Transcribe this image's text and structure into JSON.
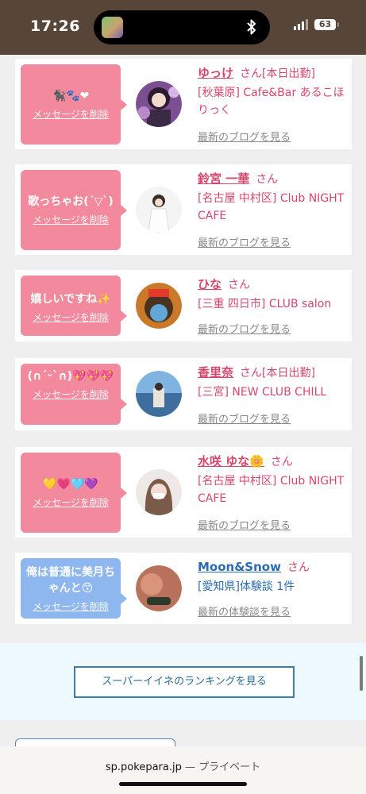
{
  "status": {
    "time": "17:26",
    "battery": "63"
  },
  "items": [
    {
      "message": "🐈‍⬛🐾❤",
      "delete_label": "メッセージを削除",
      "name": "ゆっけ",
      "san": "さん",
      "badge": "[本日出勤]",
      "shop": "[秋葉原] Cafe&Bar あるこほりっく",
      "link": "最新のブログを見る"
    },
    {
      "message": "歌っちゃお(´▽`)",
      "delete_label": "メッセージを削除",
      "name": "鈴宮 一華",
      "san": "さん",
      "badge": "",
      "shop": "[名古屋 中村区] Club NIGHT CAFE",
      "link": "最新のブログを見る"
    },
    {
      "message": "嬉しいですね✨",
      "delete_label": "メッセージを削除",
      "name": "ひな",
      "san": "さん",
      "badge": "",
      "shop": "[三重 四日市] CLUB salon",
      "link": "最新のブログを見る"
    },
    {
      "message": "(∩ˊᵕˋ∩)💖💖💖",
      "delete_label": "メッセージを削除",
      "name": "香里奈",
      "san": "さん",
      "badge": "[本日出勤]",
      "shop": "[三宮] NEW CLUB CHILL",
      "link": "最新のブログを見る"
    },
    {
      "message": "💛💗🩵💜",
      "delete_label": "メッセージを削除",
      "name": "水咲 ゆな🌼",
      "san": "さん",
      "badge": "",
      "shop": "[名古屋 中村区] Club NIGHT CAFE",
      "link": "最新のブログを見る"
    },
    {
      "message": "俺は普通に美月ちゃんと😙",
      "delete_label": "メッセージを削除",
      "name": "Moon&Snow",
      "san": "さん",
      "badge": "",
      "shop": "[愛知県]体験談 1件",
      "link": "最新の体験談を見る"
    }
  ],
  "ranking_button": "スーパーイイネのランキングを見る",
  "url_bar": {
    "domain": "sp.pokepara.jp",
    "suffix": " — プライベート"
  }
}
